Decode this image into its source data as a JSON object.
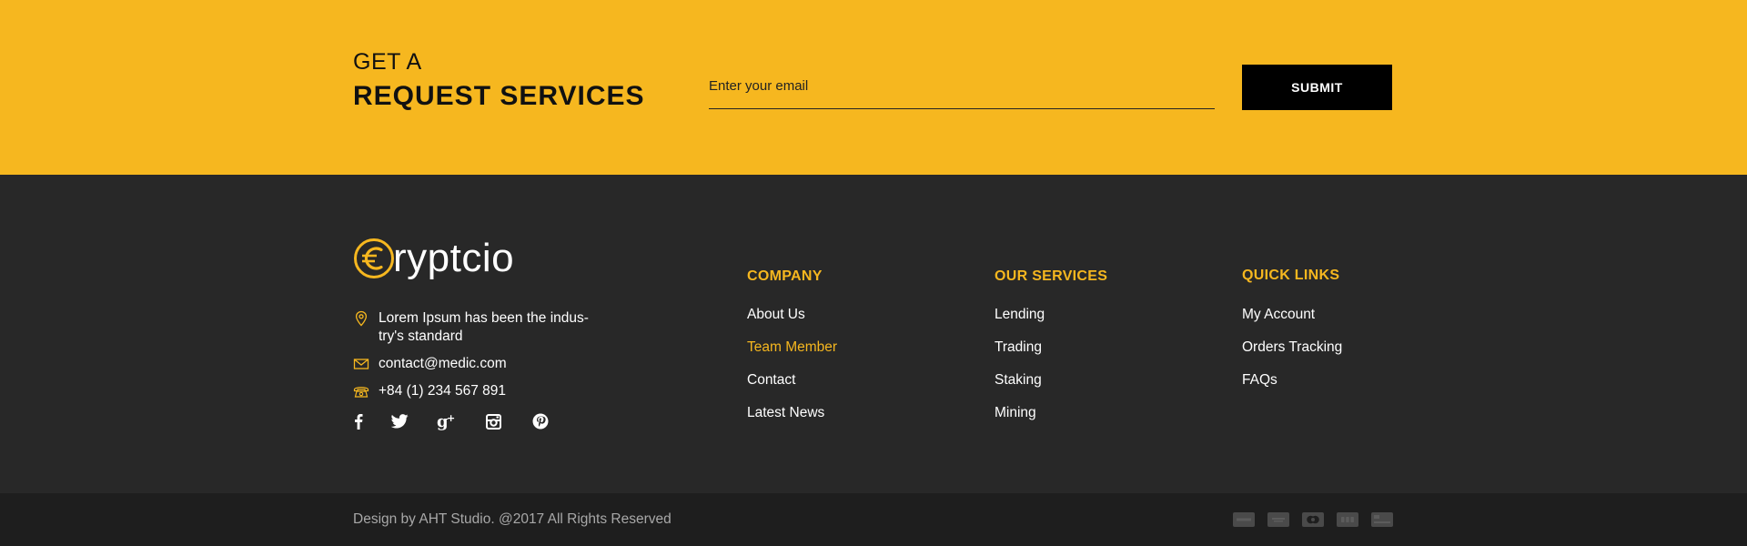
{
  "request": {
    "small_title": "GET A",
    "big_title": "REQUEST SERVICES",
    "email_placeholder": "Enter your email",
    "submit_label": "SUBMIT"
  },
  "brand": {
    "logo_text": "ryptcio",
    "logo_icon": "euro-coin-icon"
  },
  "contact": {
    "address": "Lorem Ipsum has been the indus-try's standard",
    "email": "contact@medic.com",
    "phone": "+84 (1) 234 567 891"
  },
  "social": [
    "facebook-icon",
    "twitter-icon",
    "google-plus-icon",
    "instagram-icon",
    "pinterest-icon"
  ],
  "columns": {
    "company": {
      "title": "COMPANY",
      "links": [
        "About Us",
        "Team Member",
        "Contact",
        "Latest News"
      ]
    },
    "services": {
      "title": "OUR SERVICES",
      "links": [
        "Lending",
        "Trading",
        "Staking",
        "Mining"
      ]
    },
    "quick": {
      "title": "QUICK LINKS",
      "links": [
        "My Account",
        "Orders Tracking",
        "FAQs"
      ]
    }
  },
  "active_link": "Team Member",
  "footer": {
    "copyright": "Design by AHT Studio. @2017 All Rights Reserved",
    "payments": [
      "visa-icon",
      "paypal-icon",
      "mastercard-icon",
      "jcb-icon",
      "amex-icon"
    ]
  },
  "colors": {
    "accent": "#f6b71f",
    "footer_bg": "#282828",
    "bottom_bg": "#1e1e1e"
  }
}
